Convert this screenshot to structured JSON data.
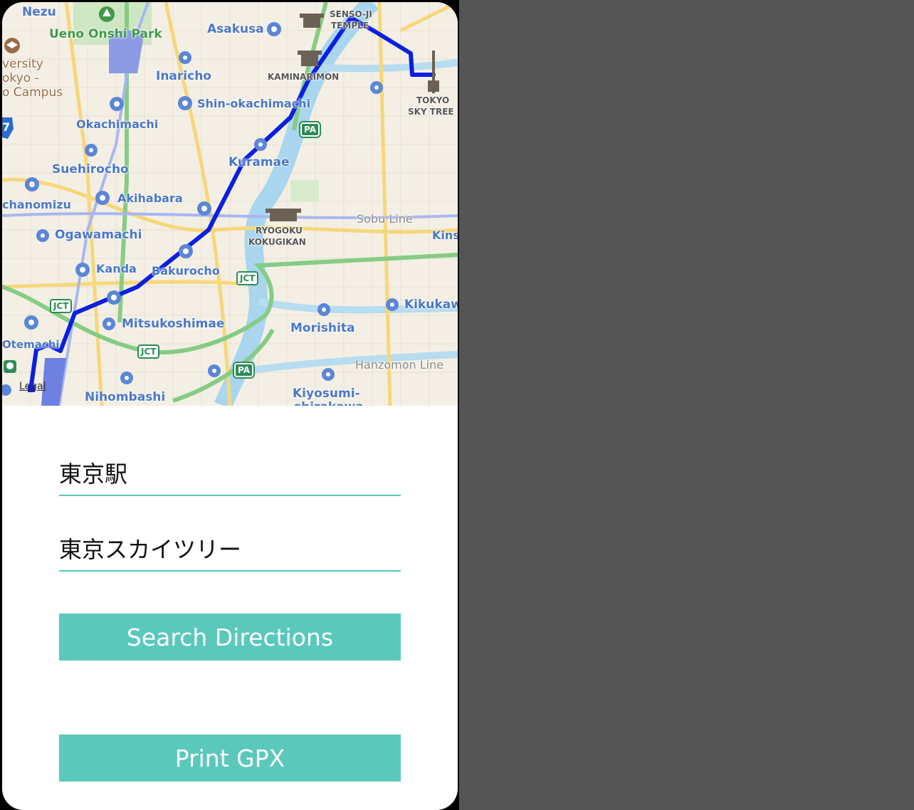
{
  "map": {
    "legal_label": "Legal",
    "route_color": "#0a1fe0",
    "labels": {
      "nezu": "Nezu",
      "ueno_onshi_park": "Ueno Onshi Park",
      "asakusa": "Asakusa",
      "senso_ji": "SENSO-JI",
      "temple": "TEMPLE",
      "university1": "versity",
      "university2": "okyo -",
      "university3": "o Campus",
      "inaricho": "Inaricho",
      "kaminarimon": "KAMINARIMON",
      "shin_okachimachi": "Shin-okachimachi",
      "tokyo": "TOKYO",
      "sky_tree": "SKY TREE",
      "okachimachi": "Okachimachi",
      "kuramae": "Kuramae",
      "suehirocho": "Suehirocho",
      "akihabara": "Akihabara",
      "ochanomizu": "chanomizu",
      "sobu_line": "Sobu Line",
      "ryogoku": "RYOGOKU",
      "kokugikan": "KOKUGIKAN",
      "kins": "Kins",
      "ogawamachi": "Ogawamachi",
      "kanda": "Kanda",
      "bakurocho": "Bakurocho",
      "kikukawa": "Kikukaw",
      "mitsukoshimae": "Mitsukoshimae",
      "morishita": "Morishita",
      "otemachi": "Otemachi",
      "hanzomon_line": "Hanzomon Line",
      "nihombashi": "Nihombashi",
      "kiyosumi": "Kiyosumi-",
      "shirakawa": "shirakawa",
      "route7": "7",
      "jct": "JCT",
      "pa": "PA"
    }
  },
  "form": {
    "origin_value": "東京駅",
    "destination_value": "東京スカイツリー",
    "search_button": "Search Directions",
    "print_button": "Print GPX"
  },
  "colors": {
    "accent": "#5bc8bc",
    "background": "#555555"
  }
}
